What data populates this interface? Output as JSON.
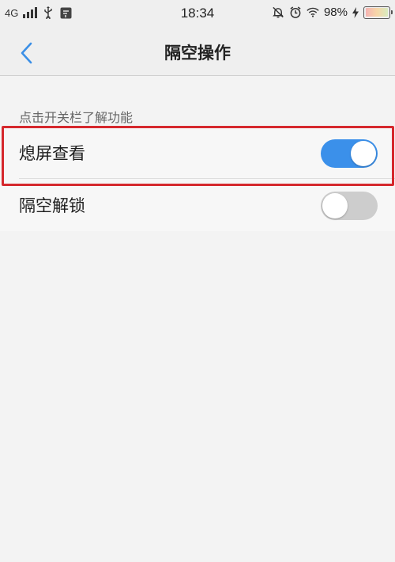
{
  "status_bar": {
    "network": "4G",
    "time": "18:34",
    "battery_percent": "98%",
    "icons": [
      "signal-icon",
      "usb-icon",
      "app-notification-icon",
      "mute-bell-icon",
      "alarm-icon",
      "wifi-icon",
      "charging-icon",
      "battery-icon"
    ]
  },
  "nav": {
    "title": "隔空操作",
    "back_icon": "chevron-left-icon"
  },
  "section": {
    "label": "点击开关栏了解功能"
  },
  "settings": [
    {
      "label": "熄屏查看",
      "enabled": true
    },
    {
      "label": "隔空解锁",
      "enabled": false
    }
  ],
  "colors": {
    "toggle_on": "#3b90ea",
    "toggle_off": "#cdcdcd",
    "highlight_border": "#d5282d"
  }
}
